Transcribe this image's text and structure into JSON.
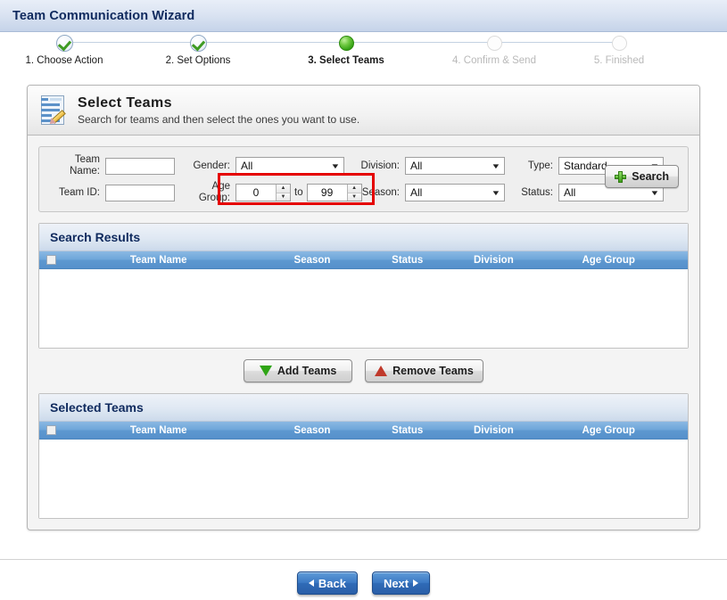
{
  "window": {
    "title": "Team Communication Wizard"
  },
  "steps": [
    {
      "label": "1. Choose Action",
      "state": "done",
      "icon": "check-circle-icon"
    },
    {
      "label": "2. Set Options",
      "state": "done",
      "icon": "check-circle-icon"
    },
    {
      "label": "3. Select Teams",
      "state": "current",
      "icon": "green-sphere-icon"
    },
    {
      "label": "4. Confirm & Send",
      "state": "todo",
      "icon": "empty-circle-icon"
    },
    {
      "label": "5. Finished",
      "state": "todo",
      "icon": "empty-circle-icon"
    }
  ],
  "panel": {
    "icon": "form-pencil-icon",
    "heading": "Select Teams",
    "subheading": "Search for teams and then select the ones you want to use."
  },
  "search_form": {
    "team_name": {
      "label": "Team Name:",
      "value": "",
      "placeholder": ""
    },
    "team_id": {
      "label": "Team ID:",
      "value": "",
      "placeholder": ""
    },
    "gender": {
      "label": "Gender:",
      "value": "All"
    },
    "age_group": {
      "label": "Age Group:",
      "from": "0",
      "to_label": "to",
      "to": "99",
      "highlighted": true,
      "highlight_color": "#e50000"
    },
    "division": {
      "label": "Division:",
      "value": "All"
    },
    "season": {
      "label": "Season:",
      "value": "All"
    },
    "type": {
      "label": "Type:",
      "value": "Standard"
    },
    "status": {
      "label": "Status:",
      "value": "All"
    },
    "search_button": {
      "label": "Search",
      "icon": "green-plus-icon"
    }
  },
  "search_results": {
    "title": "Search Results",
    "columns": [
      "Team Name",
      "Season",
      "Status",
      "Division",
      "Age Group"
    ],
    "rows": []
  },
  "transfer_buttons": {
    "add": {
      "label": "Add Teams",
      "icon": "green-triangle-down-icon"
    },
    "remove": {
      "label": "Remove Teams",
      "icon": "red-triangle-up-icon"
    }
  },
  "selected_teams": {
    "title": "Selected Teams",
    "columns": [
      "Team Name",
      "Season",
      "Status",
      "Division",
      "Age Group"
    ],
    "rows": []
  },
  "navigation": {
    "back": {
      "label": "Back",
      "icon": "arrow-left-icon"
    },
    "next": {
      "label": "Next",
      "icon": "arrow-right-icon"
    }
  }
}
